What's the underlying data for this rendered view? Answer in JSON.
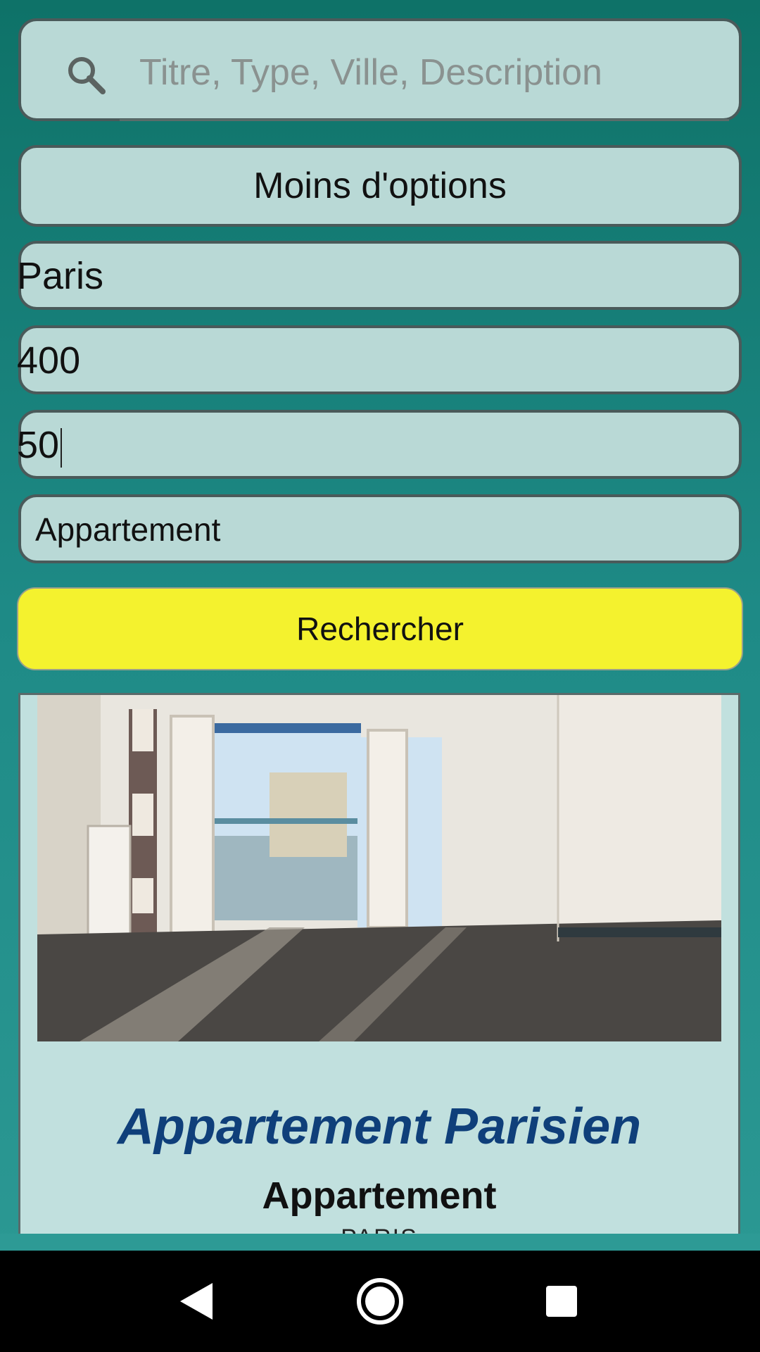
{
  "search": {
    "placeholder": "Titre, Type, Ville, Description"
  },
  "options_toggle": {
    "label": "Moins d'options"
  },
  "filters": {
    "city": "Paris",
    "price": "400",
    "surface": "50",
    "type": "Appartement"
  },
  "search_button": {
    "label": "Rechercher"
  },
  "listing": {
    "title": "Appartement Parisien",
    "type": "Appartement",
    "city": "PARIS"
  },
  "colors": {
    "accent_button": "#f4f22e",
    "title": "#0f3f7a",
    "field_bg": "#b9d9d6"
  },
  "icons": {
    "search": "search-icon",
    "back": "back-triangle-icon",
    "home": "home-circle-icon",
    "recents": "recents-square-icon"
  }
}
